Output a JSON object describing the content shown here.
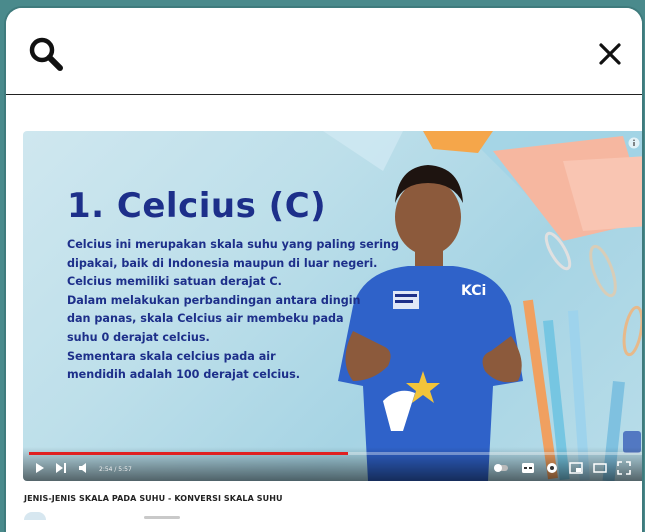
{
  "header": {
    "search_icon": "search-icon",
    "close_icon": "close-icon"
  },
  "video": {
    "heading": "1. Celcius (C)",
    "body_lines": [
      "Celcius ini merupakan skala suhu yang paling sering",
      "dipakai, baik di Indonesia maupun di luar negeri.",
      "Celcius memiliki satuan derajat C.",
      "Dalam melakukan perbandingan antara dingin",
      "dan panas, skala Celcius air membeku pada",
      "suhu 0 derajat celcius.",
      "Sementara skala celcius pada air",
      "mendidih adalah 100 derajat celcius."
    ],
    "shirt_label": "KCi",
    "progress_fraction": 0.52,
    "time_label": "2:54 / 5:57"
  },
  "caption": {
    "title": "JENIS-JENIS SKALA PADA SUHU - KONVERSI SKALA SUHU"
  },
  "colors": {
    "background": "#4a8a8c",
    "heading": "#1d2f8a",
    "progress": "#e02020",
    "shirt": "#2f62c9"
  }
}
